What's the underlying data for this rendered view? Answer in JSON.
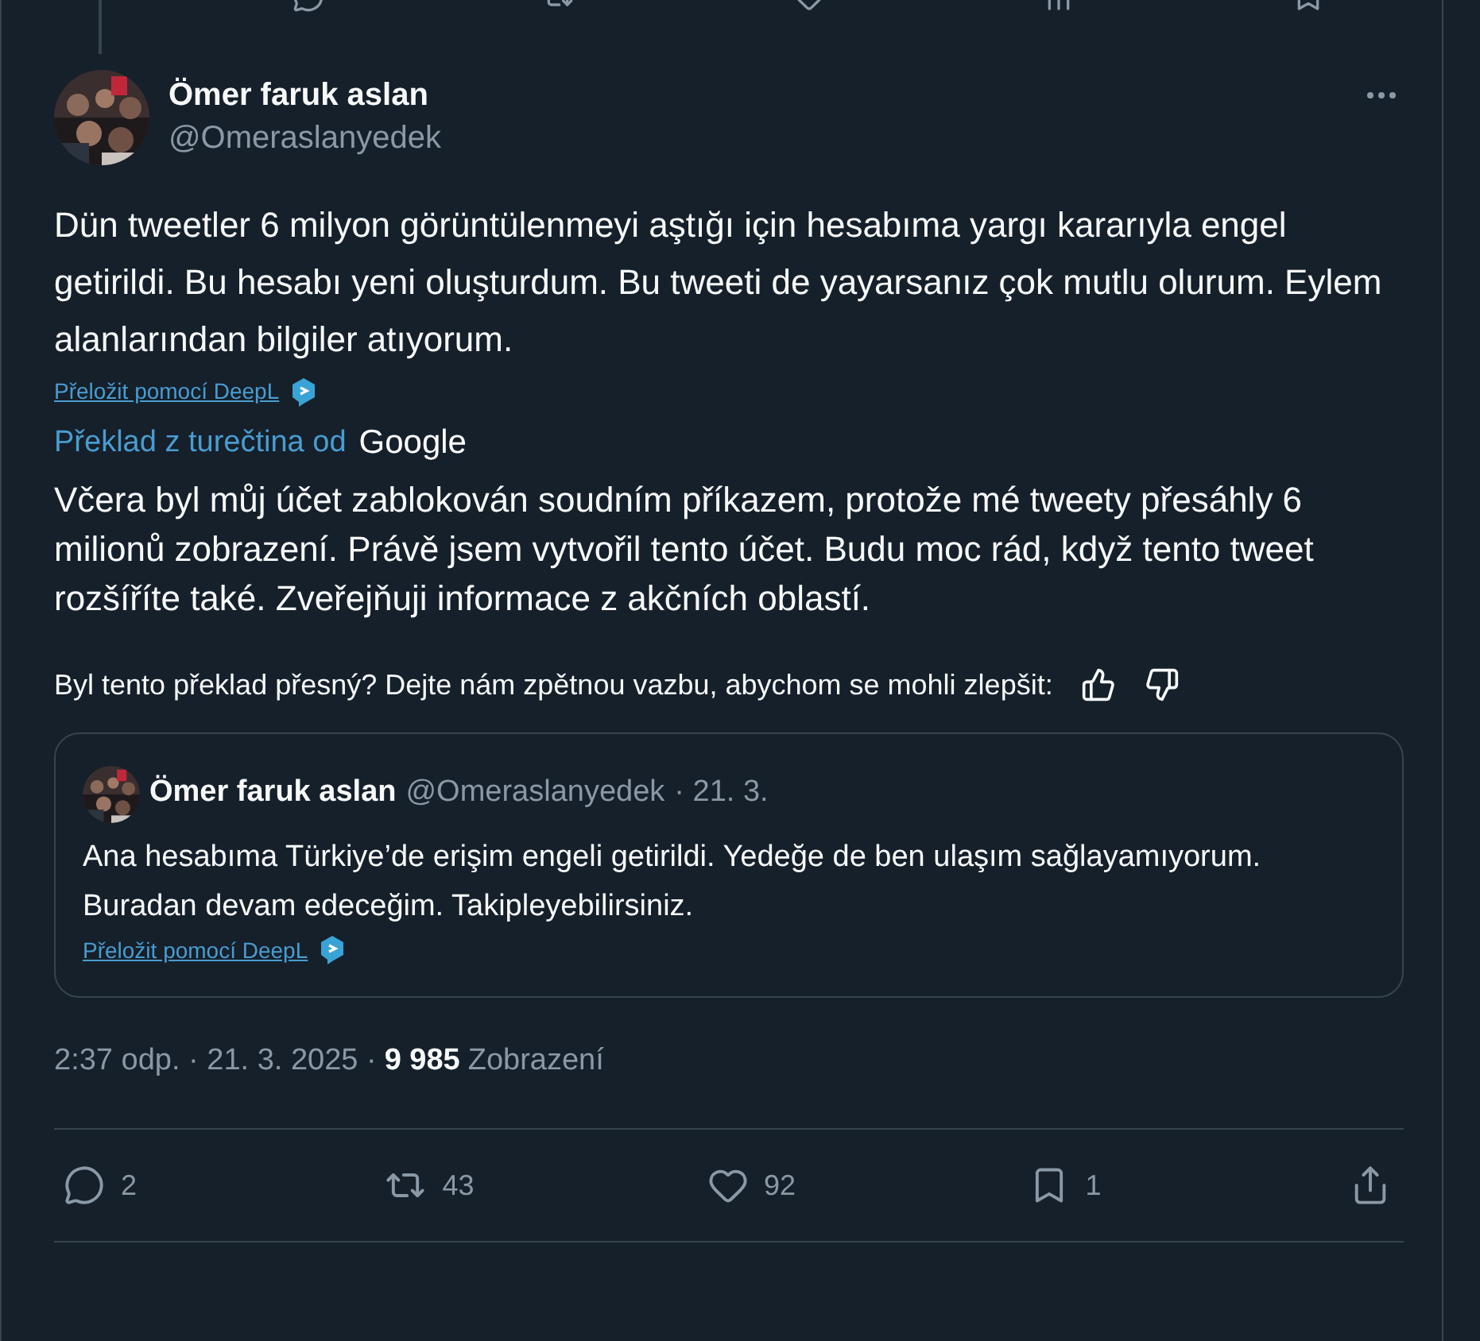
{
  "tweet": {
    "author": {
      "name": "Ömer faruk aslan",
      "handle": "@Omeraslanyedek"
    },
    "text": "Dün tweetler 6 milyon görüntülenmeyi aştığı için hesabıma yargı kararıyla engel getirildi. Bu hesabı yeni oluşturdum. Bu tweeti de yayarsanız çok mutlu olurum. Eylem alanlarından bilgiler atıyorum.",
    "deepl_link": "Přeložit pomocí DeepL",
    "translation_label": "Překlad z turečtina od",
    "translation_provider": "Google",
    "translation": "Včera byl můj účet zablokován soudním příkazem, protože mé tweety přesáhly 6 milionů zobrazení. Právě jsem vytvořil tento účet. Budu moc rád, když tento tweet rozšíříte také. Zveřejňuji informace z akčních oblastí.",
    "feedback": "Byl tento překlad přesný? Dejte nám zpětnou vazbu, abychom se mohli zlepšit:",
    "quote": {
      "name": "Ömer faruk aslan",
      "handle": "@Omeraslanyedek",
      "date": "· 21. 3.",
      "text": "Ana hesabıma Türkiye’de erişim engeli getirildi. Yedeğe de ben ulaşım sağlayamıyorum. Buradan devam edeceğim. Takipleyebilirsiniz.",
      "deepl_link": "Přeložit pomocí DeepL"
    },
    "timestamp": "2:37 odp. · 21. 3. 2025 ·",
    "views": "9 985",
    "views_label": "Zobrazení",
    "actions": [
      {
        "kind": "reply",
        "count": "2"
      },
      {
        "kind": "repost",
        "count": "43"
      },
      {
        "kind": "like",
        "count": "92"
      },
      {
        "kind": "bookmark",
        "count": "1"
      },
      {
        "kind": "share"
      }
    ]
  }
}
